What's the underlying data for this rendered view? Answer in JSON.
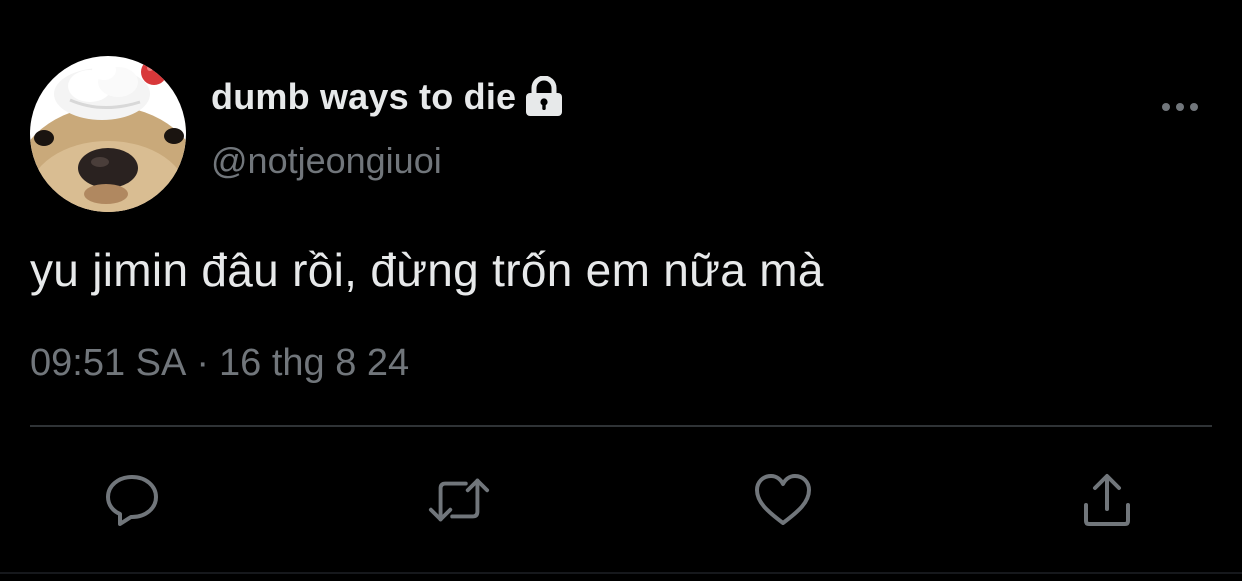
{
  "tweet": {
    "display_name": "dumb ways to die",
    "handle": "@notjeongiuoi",
    "protected": true,
    "text": "yu jimin đâu rồi, đừng trốn em nữa mà",
    "time": "09:51 SA",
    "separator": "·",
    "date": "16 thg 8 24"
  },
  "icons": {
    "lock": "lock-icon",
    "more": "more-icon",
    "reply": "reply-icon",
    "retweet": "retweet-icon",
    "like": "heart-icon",
    "share": "share-icon"
  },
  "colors": {
    "background": "#000000",
    "primary_text": "#e7e9ea",
    "secondary_text": "#71767b",
    "divider": "#2f3336"
  }
}
